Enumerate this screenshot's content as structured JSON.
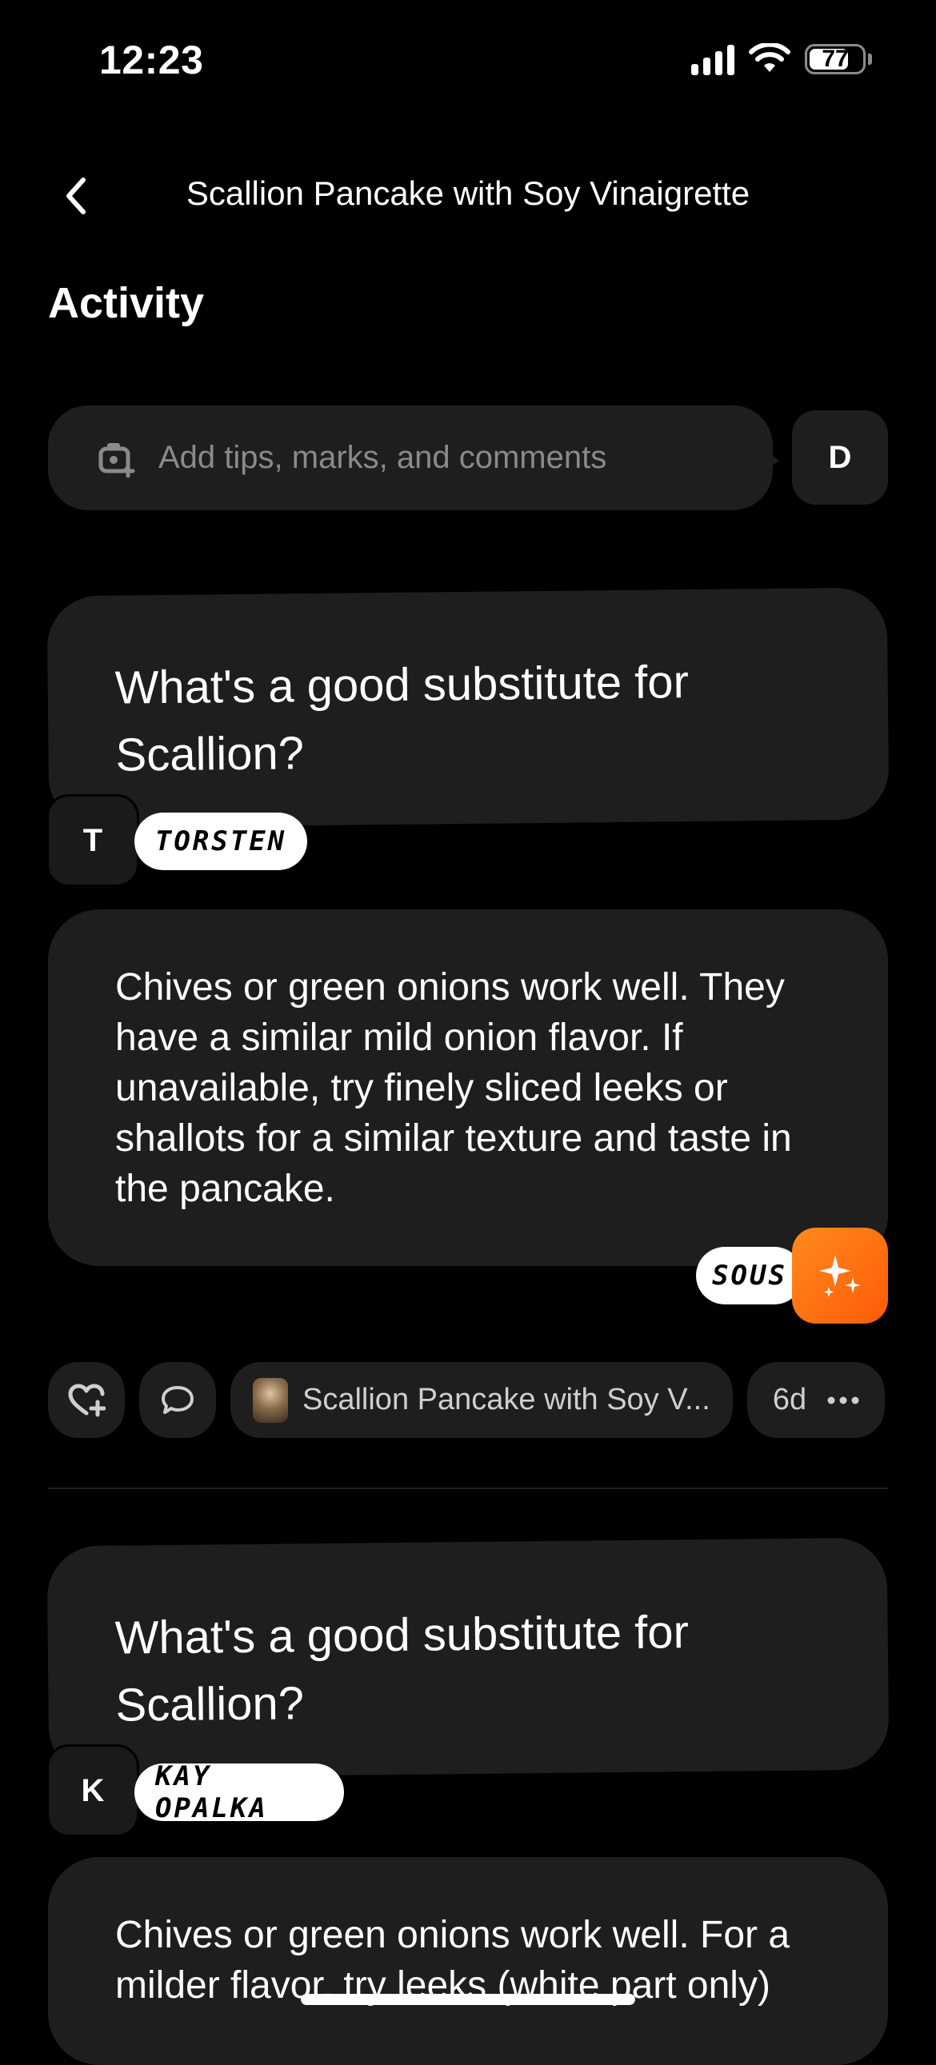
{
  "status_bar": {
    "time": "12:23",
    "battery": "77",
    "battery_level_percent": 77
  },
  "nav": {
    "title": "Scallion Pancake with Soy Vinaigrette",
    "back_icon": "chevron-left-icon"
  },
  "section": {
    "title": "Activity"
  },
  "composer": {
    "placeholder": "Add tips, marks, and comments",
    "icon": "camera-plus-icon",
    "user_initial": "D"
  },
  "threads": [
    {
      "question": "What's a good substitute for Scallion?",
      "asker_initial": "T",
      "asker_name": "TORSTEN",
      "answer": "Chives or green onions work well. They have a similar mild onion flavor. If unavailable, try finely sliced leeks or shallots for a similar texture and taste in the pancake.",
      "answerer_name": "SOUS",
      "answerer_icon": "sparkles-icon",
      "recipe_chip": "Scallion Pancake with Soy V...",
      "age": "6d"
    },
    {
      "question": "What's a good substitute for Scallion?",
      "asker_initial": "K",
      "asker_name": "KAY OPALKA",
      "answer": "Chives or green onions work well. For a milder flavor, try leeks (white part only)"
    }
  ],
  "colors": {
    "background": "#000000",
    "card": "#1e1e1e",
    "accent": "#ff6a10",
    "muted_text": "#8a8a8a"
  }
}
